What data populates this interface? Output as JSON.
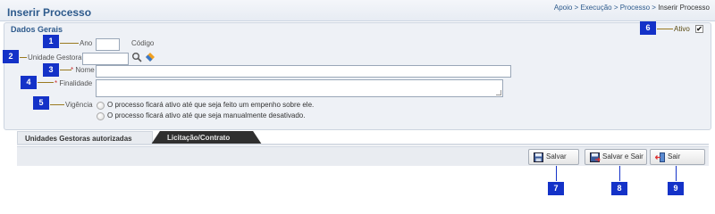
{
  "header": {
    "title": "Inserir Processo",
    "breadcrumb": [
      "Apoio",
      "Execução",
      "Processo",
      "Inserir Processo"
    ],
    "separator": " > "
  },
  "panel": {
    "title": "Dados Gerais",
    "ano_label": "Ano",
    "ano_value": "",
    "codigo_label": "Código",
    "unidade_label": "Unidade Gestora",
    "unidade_value": "",
    "nome_label": "Nome",
    "nome_value": "",
    "finalidade_label": "Finalidade",
    "finalidade_value": "",
    "vigencia_label": "Vigência",
    "vigencia_options": [
      "O processo ficará ativo até que seja feito um empenho sobre ele.",
      "O processo ficará ativo até que seja manualmente desativado."
    ],
    "ativo_label": "Ativo",
    "ativo_checked": true
  },
  "tabs": [
    "Unidades Gestoras autorizadas",
    "Licitação/Contrato"
  ],
  "buttons": {
    "salvar": "Salvar",
    "salvar_sair": "Salvar e Sair",
    "sair": "Sair"
  },
  "markers": [
    "1",
    "2",
    "3",
    "4",
    "5",
    "6",
    "7",
    "8",
    "9"
  ],
  "colors": {
    "title": "#2d5a8c",
    "marker": "#1432c8",
    "leader": "#9a7a20"
  }
}
